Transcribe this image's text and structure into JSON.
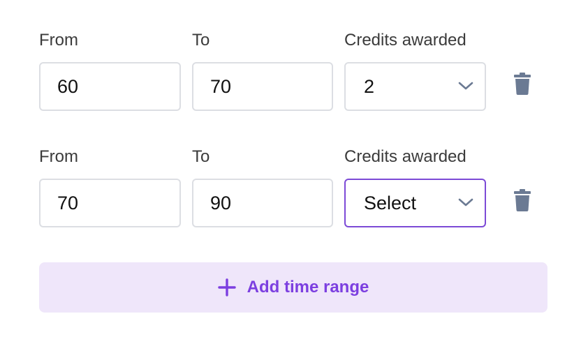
{
  "ranges": [
    {
      "from_label": "From",
      "to_label": "To",
      "credits_label": "Credits awarded",
      "from_value": "60",
      "to_value": "70",
      "credits_value": "2"
    },
    {
      "from_label": "From",
      "to_label": "To",
      "credits_label": "Credits awarded",
      "from_value": "70",
      "to_value": "90",
      "credits_value": "Select"
    }
  ],
  "add_button": {
    "label": "Add time range"
  },
  "colors": {
    "accent": "#7c3fe0",
    "accent_bg": "#efe6fa",
    "focus_border": "#7c4ad6",
    "icon_gray": "#6b7a93",
    "input_border": "#dcdee3"
  },
  "icons": {
    "delete": "trash-icon",
    "dropdown": "chevron-down-icon",
    "add": "plus-icon"
  }
}
